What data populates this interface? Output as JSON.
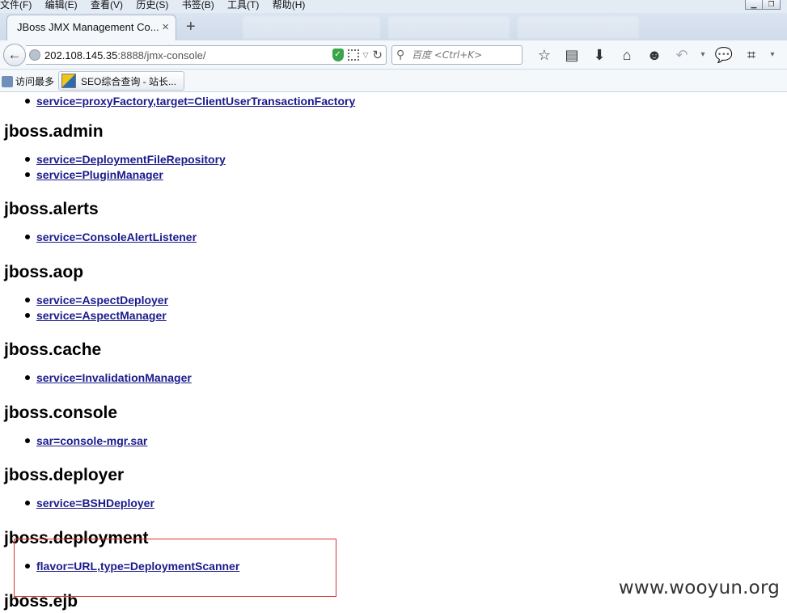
{
  "menubar": {
    "items": [
      "文件(F)",
      "编辑(E)",
      "查看(V)",
      "历史(S)",
      "书签(B)",
      "工具(T)",
      "帮助(H)"
    ]
  },
  "tabs": {
    "active_title": "JBoss JMX Management Co...",
    "close_glyph": "×",
    "new_tab_glyph": "+"
  },
  "address": {
    "host": "202.108.145.35",
    "path": ":8888/jmx-console/"
  },
  "search": {
    "placeholder": "百度 <Ctrl+K>"
  },
  "toolbar_icons": [
    "star-icon",
    "reading-list-icon",
    "download-icon",
    "home-icon",
    "emoji-icon",
    "undo-icon",
    "dropdown-icon",
    "chat-icon",
    "crop-icon",
    "menu-arrow-icon"
  ],
  "bookmarks": {
    "most_visited": "访问最多",
    "seo": "SEO综合查询 - 站长..."
  },
  "content": {
    "top_link": "service=proxyFactory,target=ClientUserTransactionFactory",
    "domains": [
      {
        "name": "jboss.admin",
        "links": [
          "service=DeploymentFileRepository",
          "service=PluginManager"
        ]
      },
      {
        "name": "jboss.alerts",
        "links": [
          "service=ConsoleAlertListener"
        ]
      },
      {
        "name": "jboss.aop",
        "links": [
          "service=AspectDeployer",
          "service=AspectManager"
        ]
      },
      {
        "name": "jboss.cache",
        "links": [
          "service=InvalidationManager"
        ]
      },
      {
        "name": "jboss.console",
        "links": [
          "sar=console-mgr.sar"
        ]
      },
      {
        "name": "jboss.deployer",
        "links": [
          "service=BSHDeployer"
        ]
      },
      {
        "name": "jboss.deployment",
        "links": [
          "flavor=URL,type=DeploymentScanner"
        ]
      },
      {
        "name": "jboss.ejb",
        "links": []
      }
    ]
  },
  "watermark": "www.wooyun.org",
  "colors": {
    "link": "#1a1a8c",
    "highlight_border": "#d93232",
    "chrome": "#dbe5f1"
  }
}
